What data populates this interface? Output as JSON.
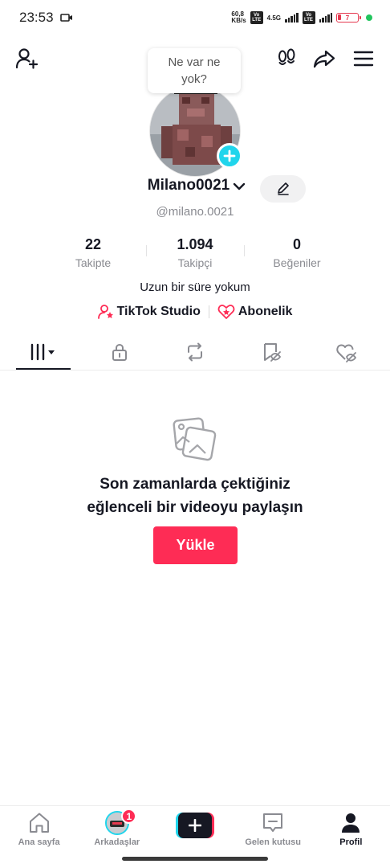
{
  "status_bar": {
    "time": "23:53",
    "net_speed_value": "60,8",
    "net_speed_unit": "KB/s",
    "network_gen": "4.5G",
    "volte_label": "Vo LTE",
    "battery_level": "7",
    "colors": {
      "battery": "#e53950",
      "charging_dot": "#22c55e"
    }
  },
  "header": {
    "status_bubble": "Ne var ne yok?",
    "icons": [
      "add-friend-icon",
      "footprints-icon",
      "share-icon",
      "menu-icon"
    ]
  },
  "profile": {
    "username": "Milano0021",
    "handle": "@milano.0021",
    "stats": [
      {
        "value": "22",
        "label": "Takipte"
      },
      {
        "value": "1.094",
        "label": "Takipçi"
      },
      {
        "value": "0",
        "label": "Beğeniler"
      }
    ],
    "bio": "Uzun bir süre yokum",
    "links": [
      {
        "label": "TikTok Studio",
        "icon": "studio-icon"
      },
      {
        "label": "Abonelik",
        "icon": "subscription-icon"
      }
    ]
  },
  "tabs": [
    {
      "icon": "videos-grid-icon",
      "active": true
    },
    {
      "icon": "lock-icon",
      "active": false
    },
    {
      "icon": "repost-icon",
      "active": false
    },
    {
      "icon": "bookmark-icon",
      "active": false
    },
    {
      "icon": "liked-icon",
      "active": false
    }
  ],
  "empty_state": {
    "title": "Son zamanlarda çektiğiniz\neğlenceli bir videoyu paylaşın",
    "button_label": "Yükle"
  },
  "bottom_nav": {
    "items": [
      {
        "label": "Ana sayfa",
        "icon": "home-icon"
      },
      {
        "label": "Arkadaşlar",
        "icon": "friends-avatar",
        "badge": "1"
      },
      {
        "label": "",
        "icon": "create-icon"
      },
      {
        "label": "Gelen kutusu",
        "icon": "inbox-icon"
      },
      {
        "label": "Profil",
        "icon": "profile-icon",
        "active": true
      }
    ]
  },
  "colors": {
    "accent": "#fe2c55",
    "secondary_accent": "#20d5ec",
    "text_primary": "#161823",
    "text_secondary": "#8a8b91"
  }
}
